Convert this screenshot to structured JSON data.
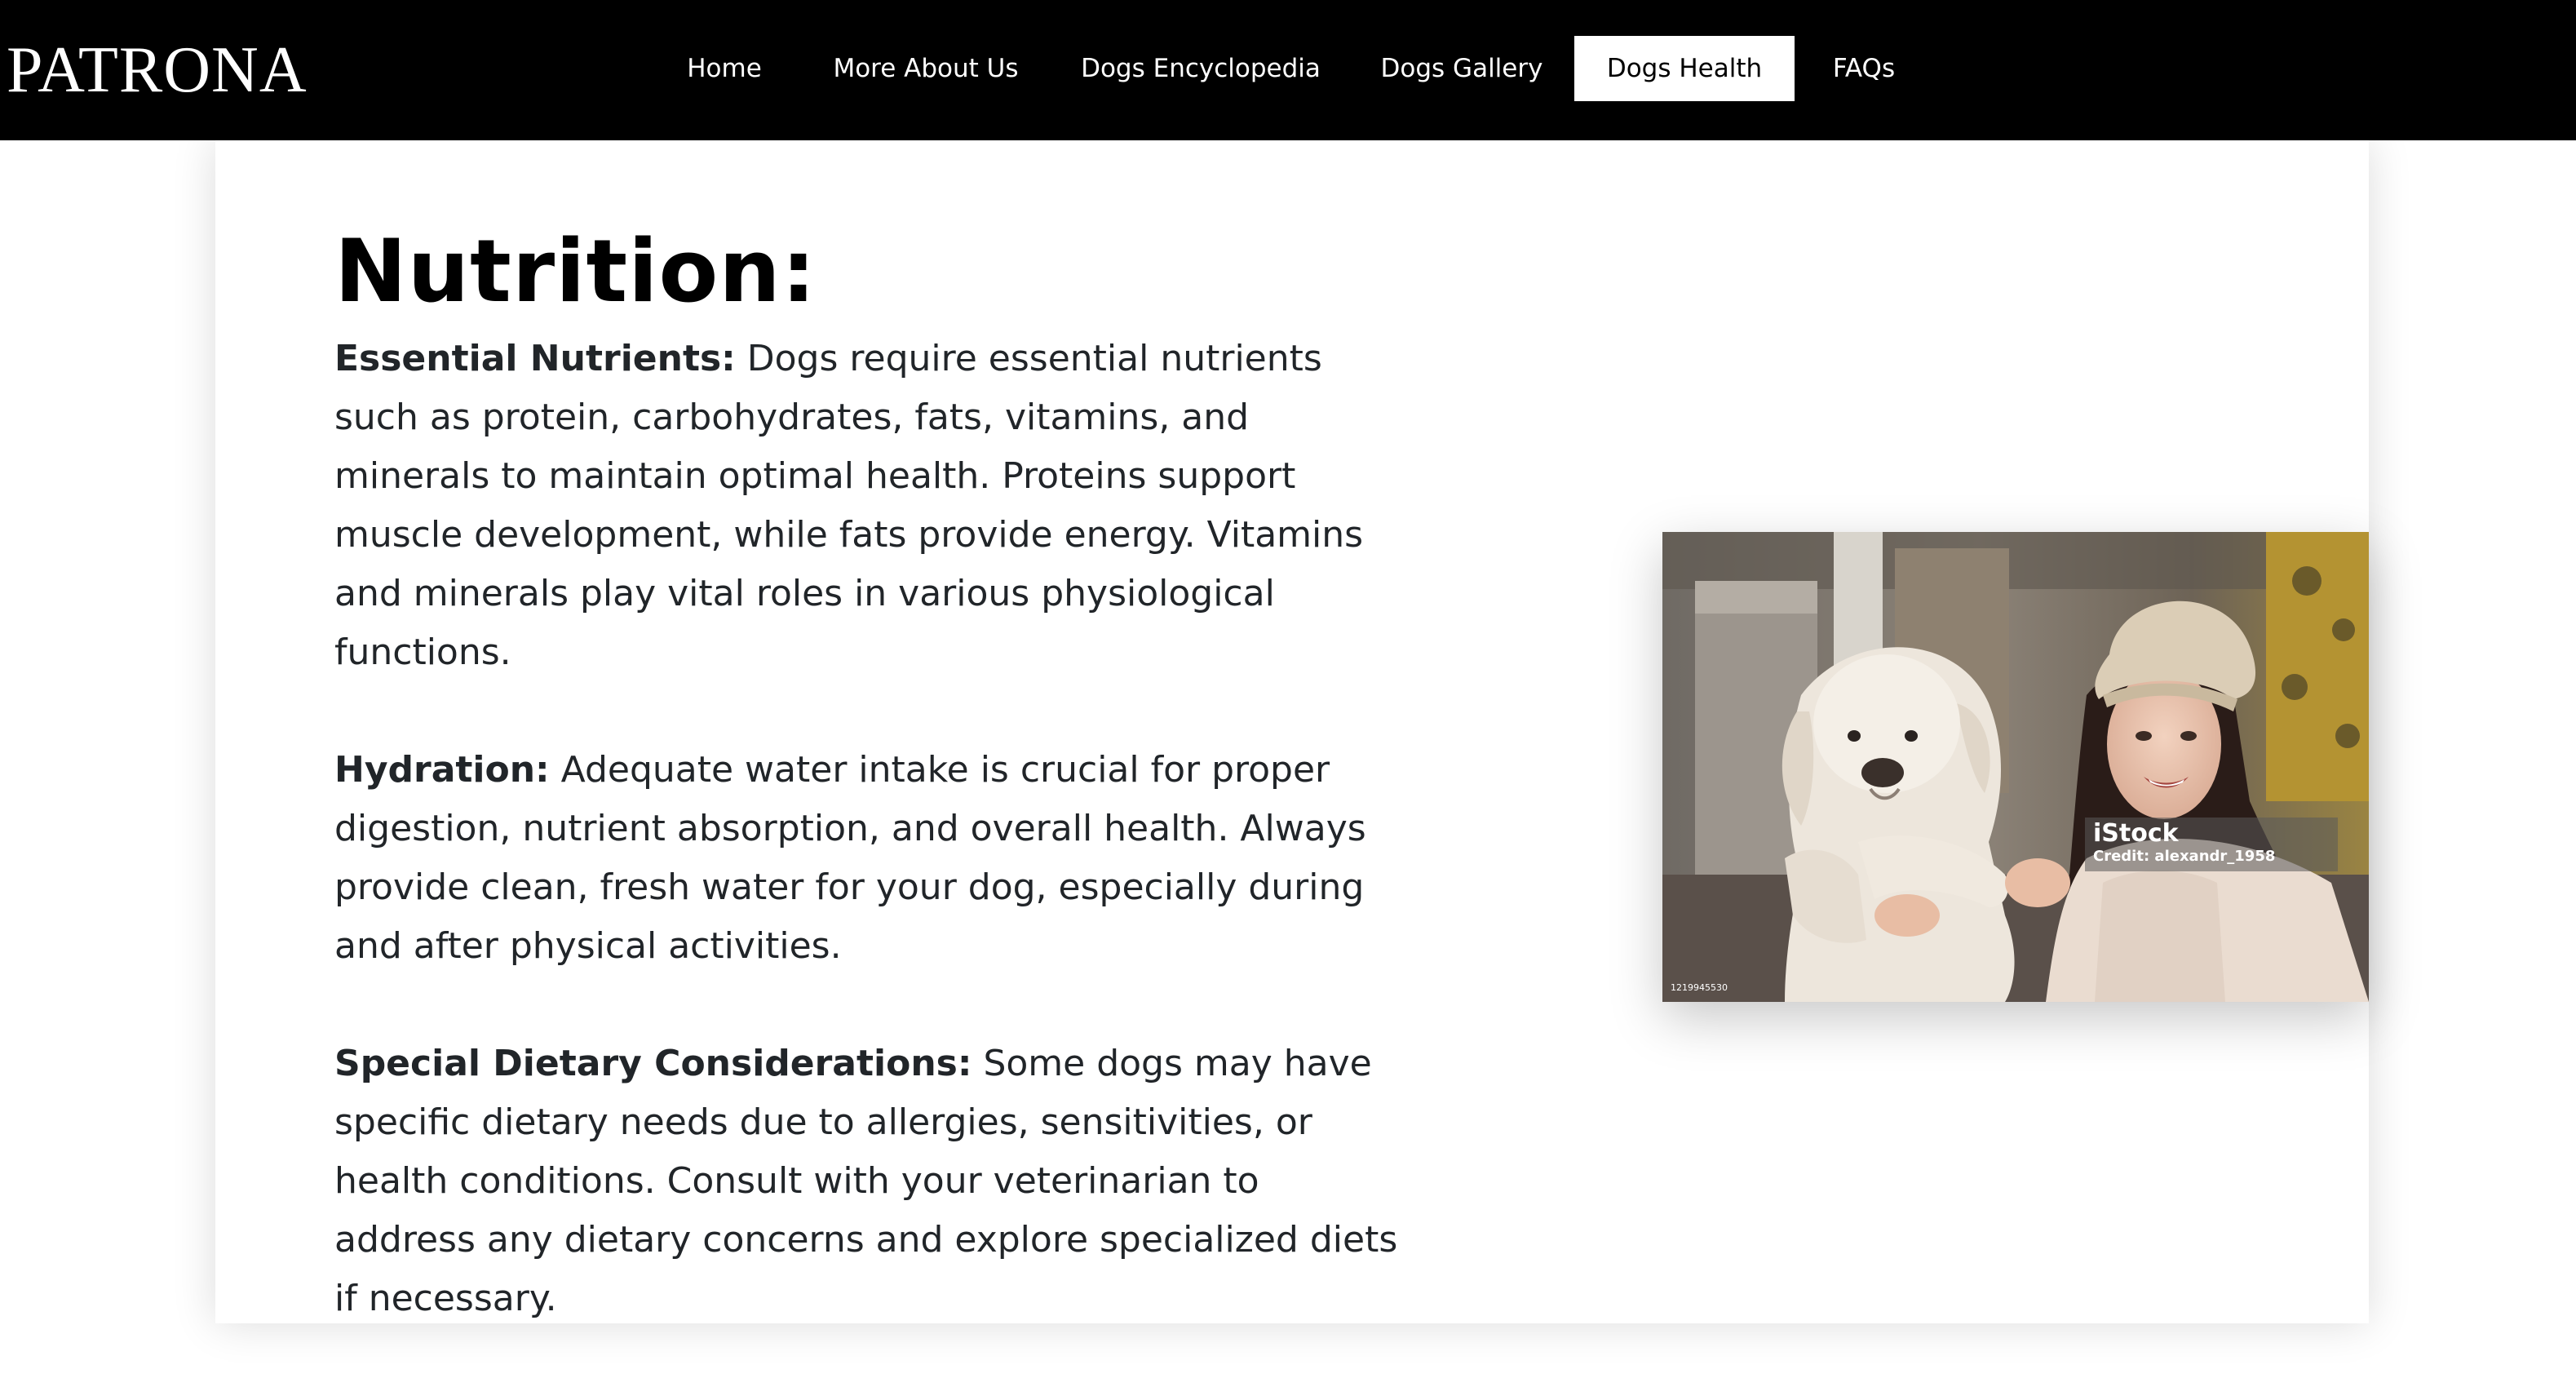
{
  "header": {
    "brand": "PATRONA",
    "nav": [
      {
        "label": "Home"
      },
      {
        "label": "More About Us"
      },
      {
        "label": "Dogs Encyclopedia"
      },
      {
        "label": "Dogs Gallery"
      },
      {
        "label": "Dogs Health",
        "active": true
      },
      {
        "label": "FAQs"
      }
    ]
  },
  "main": {
    "heading": "Nutrition:",
    "paragraphs": [
      {
        "title": "Essential Nutrients:",
        "text": " Dogs require essential nutrients such as protein, carbohydrates, fats, vitamins, and minerals to maintain optimal health. Proteins support muscle development, while fats provide energy. Vitamins and minerals play vital roles in various physiological functions."
      },
      {
        "title": "Hydration:",
        "text": " Adequate water intake is crucial for proper digestion, nutrient absorption, and overall health. Always provide clean, fresh water for your dog, especially during and after physical activities."
      },
      {
        "title": "Special Dietary Considerations:",
        "text": " Some dogs may have specific dietary needs due to allergies, sensitivities, or health conditions. Consult with your veterinarian to address any dietary concerns and explore specialized diets if necessary."
      }
    ],
    "photo": {
      "credit_brand": "iStock",
      "credit_author": "Credit: alexandr_1958",
      "stock_id": "1219945530"
    }
  },
  "colors": {
    "navbar": "#000000",
    "nav_active_bg": "#ffffff",
    "text": "#212529",
    "heading": "#000000"
  }
}
